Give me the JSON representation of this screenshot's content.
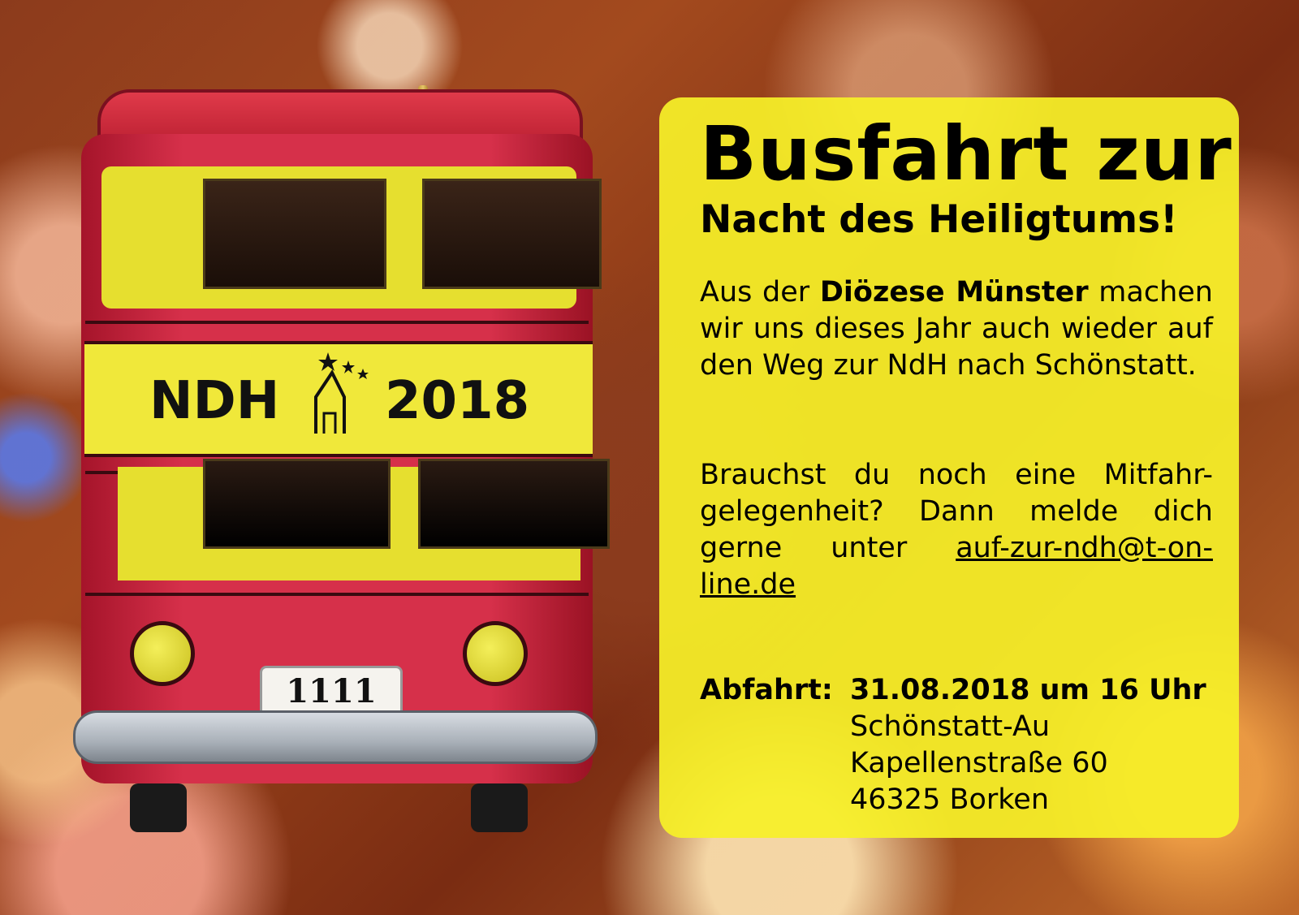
{
  "title_line1": "Busfahrt zur",
  "title_line2": "Nacht des Heiligtums!",
  "intro": {
    "prefix": "Aus der ",
    "diocese": "Diözese Münster",
    "suffix": " machen wir uns dieses Jahr auch wieder auf den Weg zur NdH nach Schönstatt."
  },
  "contact": {
    "text": "Brauchst du noch eine Mitfahr-gelegenheit? Dann melde dich gerne unter ",
    "email": "auf-zur-ndh@t-on-line.de"
  },
  "departure": {
    "label": "Abfahrt:",
    "datetime": "31.08.2018 um 16 Uhr",
    "place": "Schönstatt-Au",
    "street": "Kapellenstraße 60",
    "city": "46325 Borken"
  },
  "bus": {
    "banner_left": "NDH",
    "banner_right": "2018",
    "plate": "1111"
  },
  "colors": {
    "panel": "#f6f028",
    "bus_red": "#d6304a",
    "bus_yellow": "#e6df2f"
  }
}
